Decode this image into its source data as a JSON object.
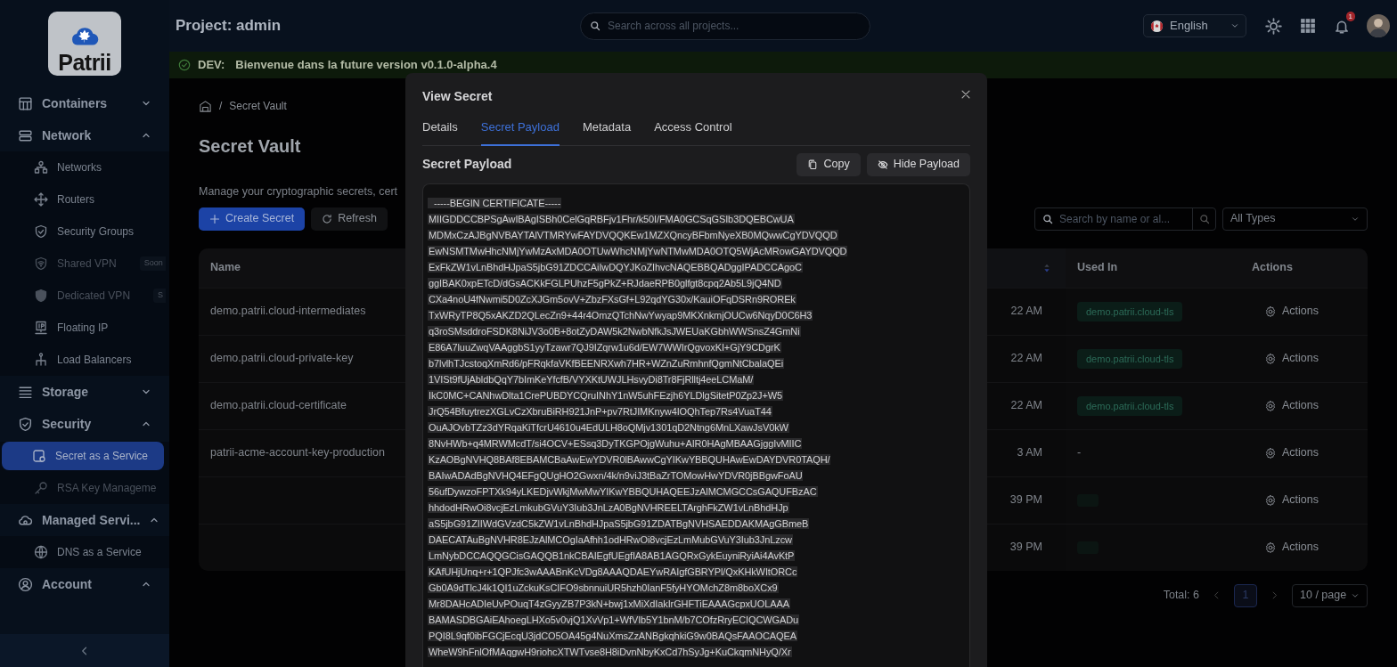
{
  "sidebar": {
    "logo": "Patrii",
    "groups": [
      {
        "label": "Containers",
        "expanded": false
      },
      {
        "label": "Network",
        "expanded": true,
        "children": [
          {
            "label": "Networks",
            "selected": false,
            "disabled": false
          },
          {
            "label": "Routers",
            "selected": false,
            "disabled": false
          },
          {
            "label": "Security Groups",
            "selected": false,
            "disabled": false
          },
          {
            "label": "Shared VPN",
            "selected": false,
            "disabled": true,
            "badge": "Soon"
          },
          {
            "label": "Dedicated VPN",
            "selected": false,
            "disabled": true,
            "badge": "S"
          },
          {
            "label": "Floating IP",
            "selected": false,
            "disabled": false
          },
          {
            "label": "Load Balancers",
            "selected": false,
            "disabled": false
          }
        ]
      },
      {
        "label": "Storage",
        "expanded": false
      },
      {
        "label": "Security",
        "expanded": true,
        "children": [
          {
            "label": "Secret as a Service",
            "selected": true,
            "disabled": false
          },
          {
            "label": "RSA Key Manageme",
            "selected": false,
            "disabled": true
          }
        ]
      },
      {
        "label": "Managed Servi...",
        "expanded": true,
        "children": [
          {
            "label": "DNS as a Service",
            "selected": false,
            "disabled": false
          }
        ]
      },
      {
        "label": "Account",
        "expanded": true
      }
    ]
  },
  "header": {
    "title": "Project: admin",
    "search": {
      "placeholder": "Search across all projects..."
    },
    "language": "English",
    "notifications": "1"
  },
  "banner": {
    "label": "DEV:",
    "message": "Bienvenue dans la future version v0.1.0-alpha.4"
  },
  "page": {
    "breadcrumb": {
      "separator": "/",
      "item": "Secret Vault"
    },
    "title": "Secret Vault",
    "description": "Manage your cryptographic secrets, cert",
    "buttons": [
      {
        "label": "Create Secret",
        "kind": "primary"
      },
      {
        "label": "Refresh",
        "kind": "refresh"
      }
    ],
    "search": {
      "placeholder": "Search by name or al..."
    },
    "type_filter": "All Types",
    "table": {
      "columns": [
        "Name",
        "Used In",
        "Actions"
      ],
      "rows": [
        {
          "name": "demo.patrii.cloud-intermediates",
          "time": "22 AM",
          "used_in": "demo.patrii.cloud-tls",
          "action": "Actions"
        },
        {
          "name": "demo.patrii.cloud-private-key",
          "time": "22 AM",
          "used_in": "demo.patrii.cloud-tls",
          "action": "Actions"
        },
        {
          "name": "demo.patrii.cloud-certificate",
          "time": "22 AM",
          "used_in": "demo.patrii.cloud-tls",
          "action": "Actions"
        },
        {
          "name": "patrii-acme-account-key-production",
          "time": "3 AM",
          "used_in": "-",
          "action": "Actions"
        },
        {
          "time": "39 PM",
          "faint_tag": true,
          "action": "Actions"
        },
        {
          "time": "39 PM",
          "faint_tag": true,
          "action": "Actions"
        }
      ]
    },
    "pagination": {
      "total": "Total: 6",
      "pages": [
        {
          "label": "1",
          "selected": true
        }
      ],
      "page_size": "10 / page"
    }
  },
  "modal": {
    "title": "View Secret",
    "tabs": [
      {
        "label": "Details",
        "selected": false
      },
      {
        "label": "Secret Payload",
        "selected": true
      },
      {
        "label": "Metadata",
        "selected": false
      },
      {
        "label": "Access Control",
        "selected": false
      }
    ],
    "section": "Secret Payload",
    "buttons": [
      {
        "label": "Copy",
        "kind": "copy"
      },
      {
        "label": "Hide Payload",
        "kind": "hide"
      }
    ],
    "payload": [
      "  -----BEGIN CERTIFICATE-----",
      "MIIGDDCCBPSgAwIBAgISBh0CelGqRBFjv1Fhr/k50I/FMA0GCSqGSIb3DQEBCwUA",
      "MDMxCzAJBgNVBAYTAlVTMRYwFAYDVQQKEw1MZXQncyBFbmNyeXB0MQwwCgYDVQQD",
      "EwNSMTMwHhcNMjYwMzAxMDA0OTUwWhcNMjYwNTMwMDA0OTQ5WjAcMRowGAYDVQQD",
      "ExFkZW1vLnBhdHJpaS5jbG91ZDCCAiIwDQYJKoZIhvcNAQEBBQADggIPADCCAgoC",
      "ggIBAK0xpETcD/dGsACKkFGLPUhzF5gPkZ+RJdaeRPB0glfgt8cpq2Ab5L9jQ4ND",
      "CXa4noU4fNwmi5D0ZcXJGm5ovV+ZbzFXsGf+L92qdYG30x/KauiOFqDSRn9ROREk",
      "TxWRyTP8Q5xAKZD2QLecZn9+44r4OmzQTchNwYwyap9MKXnkmjOUCw6NqyD0C6H3",
      "q3roSMsddroFSDK8NiJV3o0B+8otZyDAW5k2NwbNfkJsJWEUaKGbhWWSnsZ4GmNi",
      "E86A7luuZwqVAAggbS1yyTzawr7QJ9IZqrw1u6d/EW7WWIrQgvoxKI+GjY9CDgrK",
      "b7lvlhTJcstoqXmRd6/pFRqkfaVKfBEENRXwh7HR+WZnZuRmhnfQgmNtCbalaQEi",
      "1VISt9fUjAbldbQqY7bImKeYfcfB/VYXKtUWJLHsvyDi8Tr8FjRlltj4eeLCMaM/",
      "IkC0MC+CANhwDlta1CrePUBDYCQruINhY1nW5uhFEzjh6YLDlgSitetP0Zp2J+W5",
      "JrQ54BfuytrezXGLvCzXbruBiRH921JnP+pv7RtJIMKnyw4IOQhTep7Rs4VuaT44",
      "OuAJOvbTZz3dYRqaKiTfcrU4610u4EdULH8oQMjv1301qD2Ntng6MnLXawJsV0kW",
      "8NvHWb+q4MRWMcdT/si4OCV+ESsq3DyTKGPOjgWuhu+AIR0HAgMBAAGjggIvMIIC",
      "KzAOBgNVHQ8BAf8EBAMCBaAwEwYDVR0lBAwwCgYIKwYBBQUHAwEwDAYDVR0TAQH/",
      "BAIwADAdBgNVHQ4EFgQUgHO2Gwxn/4k/n9viJ3tBaZrTOMowHwYDVR0jBBgwFoAU",
      "56ufDywzoFPTXk94yLKEDjvWkjMwMwYIKwYBBQUHAQEEJzAlMCMGCCsGAQUFBzAC",
      "hhdodHRwOi8vcjEzLmkubGVuY3Iub3JnLzA0BgNVHREELTArghFkZW1vLnBhdHJp",
      "aS5jbG91ZIIWdGVzdC5kZW1vLnBhdHJpaS5jbG91ZDATBgNVHSAEDDAKMAgGBmeB",
      "DAECATAuBgNVHR8EJzAlMCOgIaAfhh1odHRwOi8vcjEzLmMubGVuY3Iub3JnLzcw",
      "LmNybDCCAQQGCisGAQQB1nkCBAIEgfUEgfIA8AB1AGQRxGykEuyniRyiAi4AvKtP",
      "KAfUHjUnq+r+1QPJfc3wAAABnKcVDg8AAAQDAEYwRAIgfGBRYPl/QxKHkWItORCc",
      "Gb0A9dTlcJ4k1QI1uZckuKsCIFO9sbnnuiUR5hzh0IanF5fyHYOMchZ8m8boXCx9",
      "Mr8DAHcADIeUvPOuqT4zGyyZB7P3kN+bwj1xMiXdIakIrGHFTiEAAAGcpxUOLAAA",
      "BAMASDBGAiEAhoegLHXo5v0vjQ1XvVp1+WfVIb5Y1bnM/b7COfzRryECIQCWGADu",
      "PQI8L9qf0ibFGCjEcqU3jdCO5OA45g4NuXmsZzANBgkqhkiG9w0BAQsFAAOCAQEA",
      "WheW9hFnlOfMAqgwH9riohcXTWTvse8H8iDvnNbyKxCd7hSyJg+KuCkqmNHyQ/Xr"
    ]
  }
}
